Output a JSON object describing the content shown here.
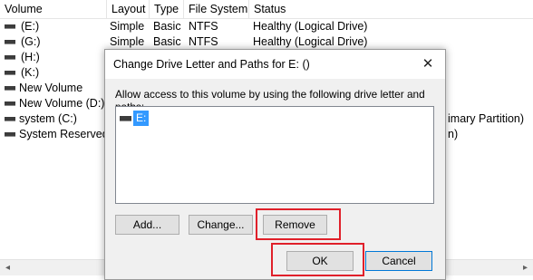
{
  "columns": [
    "Volume",
    "Layout",
    "Type",
    "File System",
    "Status"
  ],
  "rows": [
    {
      "volume": "(E:)",
      "layout": "Simple",
      "type": "Basic",
      "fs": "NTFS",
      "status": "Healthy (Logical Drive)"
    },
    {
      "volume": "(G:)",
      "layout": "Simple",
      "type": "Basic",
      "fs": "NTFS",
      "status": "Healthy (Logical Drive)"
    },
    {
      "volume": "(H:)",
      "layout": "",
      "type": "",
      "fs": "",
      "status": ""
    },
    {
      "volume": "(K:)",
      "layout": "",
      "type": "",
      "fs": "",
      "status": ""
    },
    {
      "volume": "New Volume",
      "layout": "",
      "type": "",
      "fs": "",
      "status": ""
    },
    {
      "volume": "New Volume (D:)",
      "layout": "",
      "type": "",
      "fs": "",
      "status": ""
    },
    {
      "volume": "system (C:)",
      "layout": "",
      "type": "",
      "fs": "",
      "status": "imary Partition)"
    },
    {
      "volume": "System Reserved",
      "layout": "",
      "type": "",
      "fs": "",
      "status": "n)"
    }
  ],
  "scrollbar": {
    "left_arrow": "◂",
    "right_arrow": "▸"
  },
  "dialog": {
    "title": "Change Drive Letter and Paths for E: ()",
    "close": "✕",
    "description": "Allow access to this volume by using the following drive letter and paths:",
    "paths": [
      "E:"
    ],
    "buttons": {
      "add": "Add...",
      "change": "Change...",
      "remove": "Remove",
      "ok": "OK",
      "cancel": "Cancel"
    }
  },
  "colors": {
    "highlight_box": "#e0202a",
    "selection": "#3399ff",
    "focus_border": "#0078d7"
  }
}
